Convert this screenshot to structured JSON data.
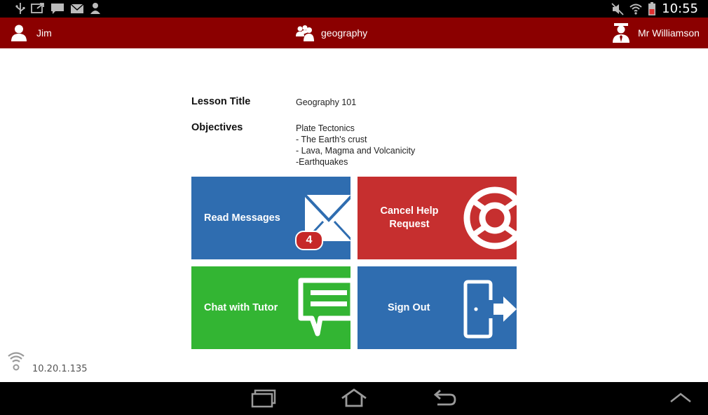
{
  "status_bar": {
    "time": "10:55",
    "left_icons": [
      "usb-icon",
      "screen-share-icon",
      "chat-notification-icon",
      "gmail-icon",
      "contact-icon"
    ],
    "right_icons": [
      "mute-icon",
      "wifi-icon",
      "battery-icon"
    ]
  },
  "header": {
    "student_name": "Jim",
    "class_name": "geography",
    "teacher_name": "Mr Williamson"
  },
  "lesson": {
    "title_label": "Lesson Title",
    "title_value": "Geography 101",
    "objectives_label": "Objectives",
    "objectives": [
      "Plate Tectonics",
      "- The Earth's crust",
      "- Lava, Magma and Volcanicity",
      "-Earthquakes"
    ]
  },
  "tiles": {
    "read_messages": {
      "label": "Read Messages",
      "badge": "4",
      "color": "#2f6db0"
    },
    "cancel_help": {
      "label_line1": "Cancel Help",
      "label_line2": "Request",
      "color": "#c62f2f"
    },
    "chat_tutor": {
      "label": "Chat with Tutor",
      "color": "#33b533"
    },
    "sign_out": {
      "label": "Sign Out",
      "color": "#2f6db0"
    }
  },
  "footer": {
    "ip_address": "10.20.1.135"
  },
  "colors": {
    "header_bg": "#8b0000",
    "status_bg": "#000000"
  }
}
